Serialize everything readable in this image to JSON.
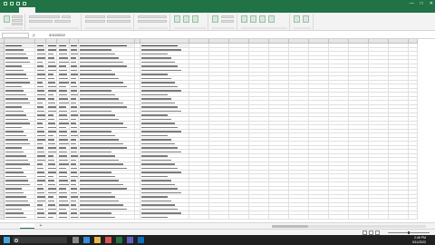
{
  "window": {
    "title": "",
    "controls": [
      "—",
      "□",
      "✕"
    ]
  },
  "ribbon_tabs": [
    "",
    "",
    "",
    "",
    "",
    "",
    "",
    "",
    ""
  ],
  "formula_bar": {
    "name_box": "",
    "fx": "fx",
    "value": "3/10/2022"
  },
  "sheet": {
    "active_tab": "",
    "add_sheet": "+"
  },
  "taskbar": {
    "time": "2:48 PM",
    "date": "3/11/2022"
  },
  "colors": {
    "excel_green": "#217346",
    "taskbar": "#202020"
  },
  "icons": [
    "windows-start-icon",
    "search-icon",
    "task-view-icon",
    "edge-icon",
    "file-explorer-icon",
    "chrome-icon",
    "excel-icon",
    "teams-icon",
    "outlook-icon"
  ]
}
